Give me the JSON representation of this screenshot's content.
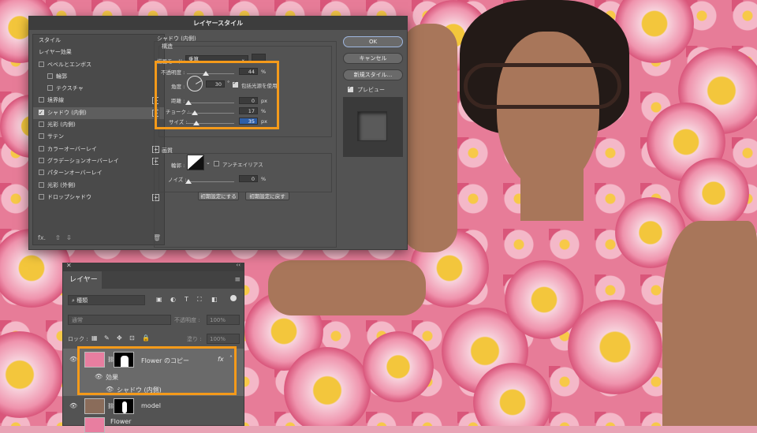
{
  "dialog": {
    "title": "レイヤースタイル",
    "styles_header": "スタイル",
    "layer_effects_header": "レイヤー効果",
    "effects": [
      {
        "label": "ベベルとエンボス",
        "checked": false,
        "sub": false,
        "plus": false
      },
      {
        "label": "輪郭",
        "checked": false,
        "sub": true,
        "plus": false
      },
      {
        "label": "テクスチャ",
        "checked": false,
        "sub": true,
        "plus": false
      },
      {
        "label": "境界線",
        "checked": false,
        "sub": false,
        "plus": true
      },
      {
        "label": "シャドウ (内側)",
        "checked": true,
        "sub": false,
        "plus": true
      },
      {
        "label": "光彩 (内側)",
        "checked": false,
        "sub": false,
        "plus": false
      },
      {
        "label": "サテン",
        "checked": false,
        "sub": false,
        "plus": false
      },
      {
        "label": "カラーオーバーレイ",
        "checked": false,
        "sub": false,
        "plus": true
      },
      {
        "label": "グラデーションオーバーレイ",
        "checked": false,
        "sub": false,
        "plus": true
      },
      {
        "label": "パターンオーバーレイ",
        "checked": false,
        "sub": false,
        "plus": false
      },
      {
        "label": "光彩 (外側)",
        "checked": false,
        "sub": false,
        "plus": false
      },
      {
        "label": "ドロップシャドウ",
        "checked": false,
        "sub": false,
        "plus": true
      }
    ],
    "footer_fx": "fx.",
    "section_title": "シャドウ (内側)",
    "structure_label": "構造",
    "blend_mode_label": "描画モード :",
    "blend_mode_value": "乗算",
    "opacity_label": "不透明度 :",
    "opacity_value": "44",
    "angle_label": "角度 :",
    "angle_value": "30",
    "angle_unit": "°",
    "global_light_label": "包括光源を使用",
    "distance_label": "距離 :",
    "distance_value": "0",
    "choke_label": "チョーク :",
    "choke_value": "17",
    "size_label": "サイズ :",
    "size_value": "35",
    "quality_label": "画質",
    "contour_label": "輪郭 :",
    "antialias_label": "アンチエイリアス",
    "noise_label": "ノイズ :",
    "noise_value": "0",
    "unit_percent": "%",
    "unit_px": "px",
    "reset_default_btn": "初期設定にする",
    "restore_default_btn": "初期設定に戻す",
    "ok_btn": "OK",
    "cancel_btn": "キャンセル",
    "new_style_btn": "新規スタイル...",
    "preview_label": "プレビュー"
  },
  "layers_panel": {
    "tab": "レイヤー",
    "filter_kind": "種類",
    "blend_mode": "通常",
    "opacity_label": "不透明度 :",
    "opacity_value": "100%",
    "lock_label": "ロック :",
    "fill_label": "塗り :",
    "fill_value": "100%",
    "layers": [
      {
        "name": "Flower のコピー",
        "fx": "fx"
      },
      {
        "name": "効果",
        "type": "effects"
      },
      {
        "name": "シャドウ (内側)",
        "type": "effect"
      },
      {
        "name": "model"
      },
      {
        "name": "Flower"
      }
    ]
  },
  "colors": {
    "accent_orange": "#f59a1a",
    "dialog_bg": "#535353",
    "panel_bg": "#535353"
  }
}
